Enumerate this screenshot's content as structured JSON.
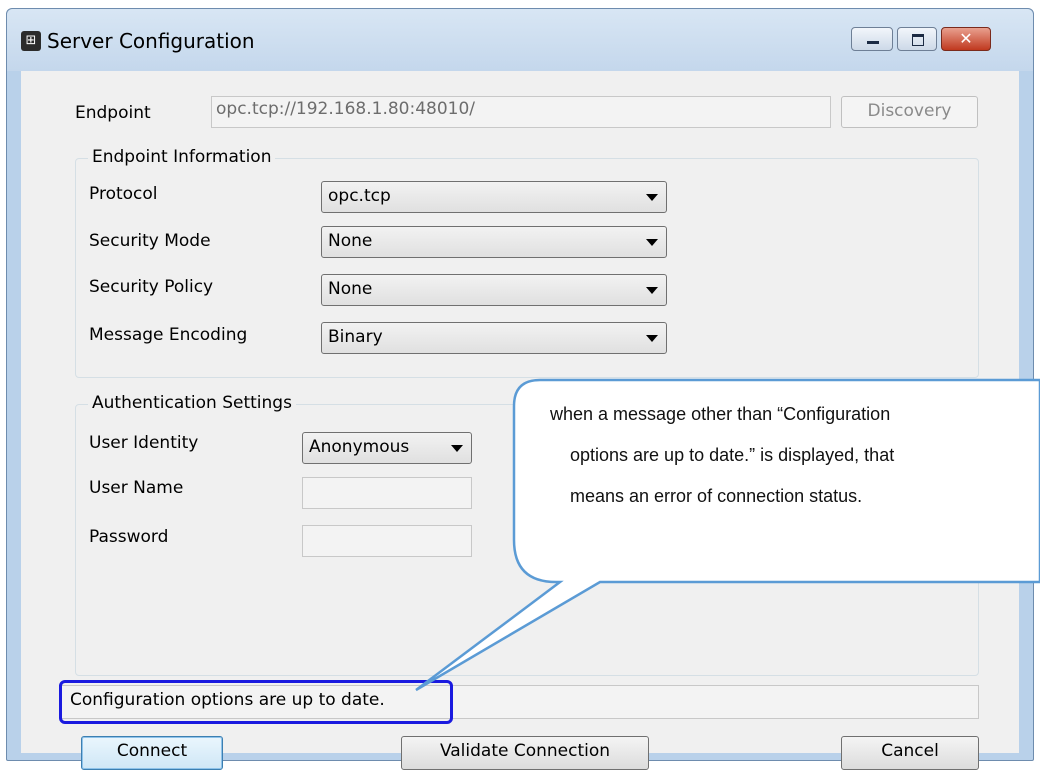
{
  "window": {
    "title": "Server Configuration",
    "icon": "server-config-icon",
    "close_glyph": "✕"
  },
  "endpoint": {
    "label": "Endpoint",
    "value": "opc.tcp://192.168.1.80:48010/",
    "discovery_label": "Discovery"
  },
  "endpoint_info": {
    "title": "Endpoint Information",
    "protocol_label": "Protocol",
    "protocol_value": "opc.tcp",
    "security_mode_label": "Security Mode",
    "security_mode_value": "None",
    "security_policy_label": "Security Policy",
    "security_policy_value": "None",
    "message_encoding_label": "Message Encoding",
    "message_encoding_value": "Binary"
  },
  "auth": {
    "title": "Authentication Settings",
    "user_identity_label": "User Identity",
    "user_identity_value": "Anonymous",
    "user_name_label": "User Name",
    "user_name_value": "",
    "password_label": "Password",
    "password_value": ""
  },
  "status": {
    "text": "Configuration options are up to date."
  },
  "buttons": {
    "connect": "Connect",
    "validate": "Validate Connection",
    "cancel": "Cancel"
  },
  "callout": {
    "line1": "when a message other than “Configuration",
    "line2": "options are up to date.” is displayed, that",
    "line3": "means an error of connection status."
  },
  "colors": {
    "highlight": "#1a1adf",
    "callout_border": "#5b9bd5"
  }
}
